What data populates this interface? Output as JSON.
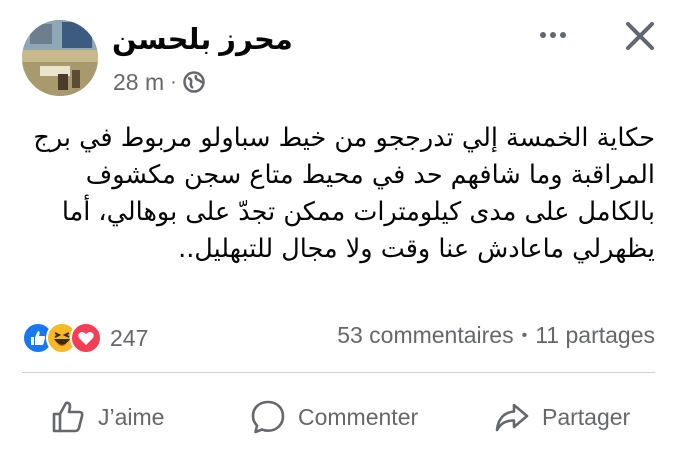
{
  "post": {
    "author": "محرز بلحسن",
    "time": "28 m",
    "privacy_icon": "globe-icon",
    "text_lines": [
      "حكاية الخمسة إلي تدرججو من خيط سباولو مربوط في برج",
      "المراقبة وما شافهم حد في محيط متاع سجن مكشوف",
      "بالكامل على مدى كيلومترات ممكن تجدّ على بوهالي، أما",
      "يظهرلي ماعادش عنا وقت ولا مجال للتبهليل.."
    ]
  },
  "reactions": {
    "icons": [
      "like-icon",
      "haha-icon",
      "love-icon"
    ],
    "count": "247",
    "comments": "53 commentaires",
    "separator": "•",
    "shares": "11 partages"
  },
  "actions": {
    "like_label": "J’aime",
    "comment_label": "Commenter",
    "share_label": "Partager"
  },
  "colors": {
    "like_blue": "#1877f2",
    "haha_yellow": "#f7b928",
    "love_red": "#f33e58",
    "secondary_text": "#65676b"
  }
}
